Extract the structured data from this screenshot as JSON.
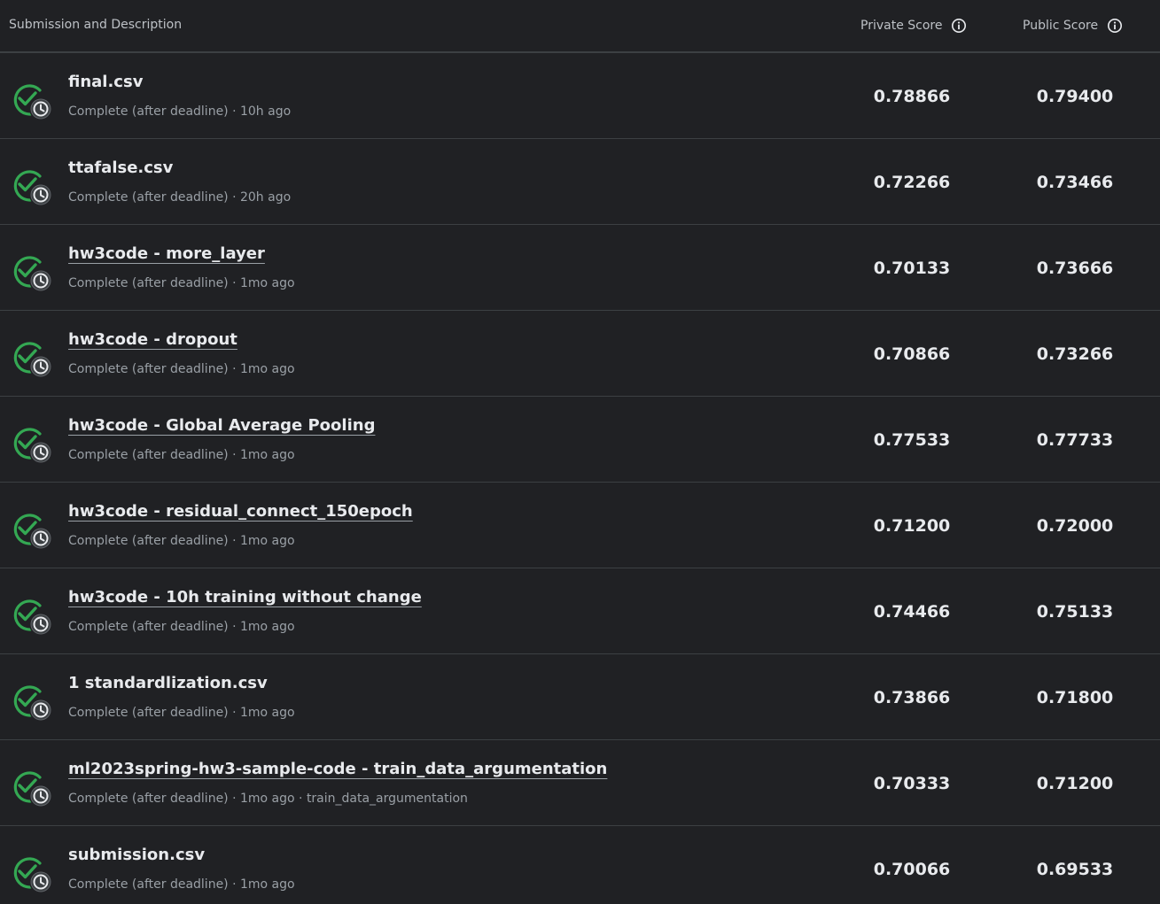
{
  "header": {
    "description_label": "Submission and Description",
    "private_label": "Private Score",
    "public_label": "Public Score"
  },
  "colors": {
    "success": "#34a853",
    "background": "#202124",
    "divider": "#3c4043"
  },
  "icons": {
    "status": "check-clock-icon",
    "info": "info-icon"
  },
  "rows": [
    {
      "title": "final.csv",
      "link": false,
      "meta": "Complete (after deadline) · 10h ago",
      "private": "0.78866",
      "public": "0.79400"
    },
    {
      "title": "ttafalse.csv",
      "link": false,
      "meta": "Complete (after deadline) · 20h ago",
      "private": "0.72266",
      "public": "0.73466"
    },
    {
      "title": "hw3code - more_layer",
      "link": true,
      "meta": "Complete (after deadline) · 1mo ago",
      "private": "0.70133",
      "public": "0.73666"
    },
    {
      "title": "hw3code - dropout",
      "link": true,
      "meta": "Complete (after deadline) · 1mo ago",
      "private": "0.70866",
      "public": "0.73266"
    },
    {
      "title": "hw3code - Global Average Pooling",
      "link": true,
      "meta": "Complete (after deadline) · 1mo ago",
      "private": "0.77533",
      "public": "0.77733"
    },
    {
      "title": "hw3code - residual_connect_150epoch",
      "link": true,
      "meta": "Complete (after deadline) · 1mo ago",
      "private": "0.71200",
      "public": "0.72000"
    },
    {
      "title": "hw3code - 10h training without change",
      "link": true,
      "meta": "Complete (after deadline) · 1mo ago",
      "private": "0.74466",
      "public": "0.75133"
    },
    {
      "title": "1 standardlization.csv",
      "link": false,
      "meta": "Complete (after deadline) · 1mo ago",
      "private": "0.73866",
      "public": "0.71800"
    },
    {
      "title": "ml2023spring-hw3-sample-code - train_data_argumentation",
      "link": true,
      "meta": "Complete (after deadline) · 1mo ago · train_data_argumentation",
      "private": "0.70333",
      "public": "0.71200"
    },
    {
      "title": "submission.csv",
      "link": false,
      "meta": "Complete (after deadline) · 1mo ago",
      "private": "0.70066",
      "public": "0.69533"
    }
  ]
}
